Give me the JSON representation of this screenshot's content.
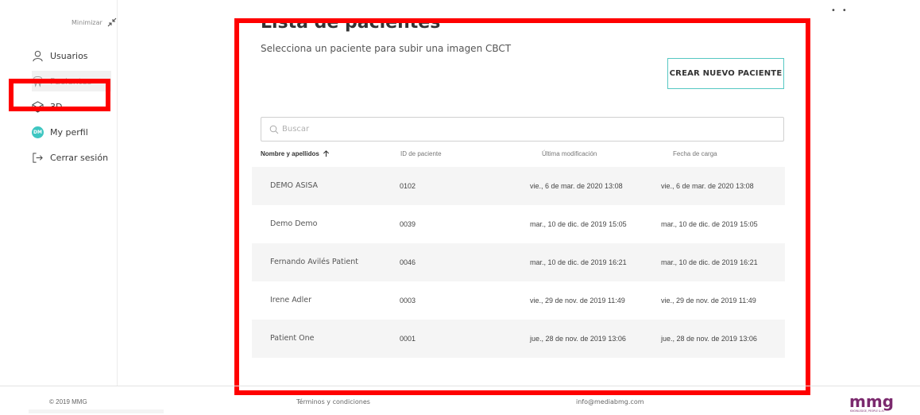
{
  "sidebar": {
    "minimize_label": "Minimizar",
    "items": [
      {
        "label": "Usuarios",
        "icon": "user-icon"
      },
      {
        "label": "Pacientes",
        "icon": "tooth-icon"
      },
      {
        "label": "3D",
        "icon": "cube-icon"
      },
      {
        "label": "My perfil",
        "icon": "avatar",
        "avatar_initials": "DM"
      },
      {
        "label": "Cerrar sesión",
        "icon": "logout-icon"
      }
    ]
  },
  "main": {
    "title": "Lista de pacientes",
    "subtitle": "Selecciona un paciente para subir una imagen CBCT",
    "create_button": "CREAR NUEVO PACIENTE",
    "search_placeholder": "Buscar",
    "table": {
      "columns": [
        "Nombre y apellidos",
        "ID de paciente",
        "Última modificación",
        "Fecha de carga"
      ],
      "rows": [
        {
          "name": "DEMO ASISA",
          "id": "0102",
          "modified": "vie., 6 de mar. de 2020 13:08",
          "loaded": "vie., 6 de mar. de 2020 13:08"
        },
        {
          "name": "Demo Demo",
          "id": "0039",
          "modified": "mar., 10 de dic. de 2019 15:05",
          "loaded": "mar., 10 de dic. de 2019 15:05"
        },
        {
          "name": "Fernando Avilés Patient",
          "id": "0046",
          "modified": "mar., 10 de dic. de 2019 16:21",
          "loaded": "mar., 10 de dic. de 2019 16:21"
        },
        {
          "name": "Irene Adler",
          "id": "0003",
          "modified": "vie., 29 de nov. de 2019 11:49",
          "loaded": "vie., 29 de nov. de 2019 11:49"
        },
        {
          "name": "Patient One",
          "id": "0001",
          "modified": "jue., 28 de nov. de 2019 13:06",
          "loaded": "jue., 28 de nov. de 2019 13:06"
        }
      ]
    }
  },
  "footer": {
    "copyright": "© 2019 MMG",
    "terms": "Términos y condiciones",
    "email": "info@mediabmg.com",
    "logo_text": "mmg",
    "logo_tagline": "KNOWLEDGE, PEOPLE & AI"
  },
  "colors": {
    "accent": "#3ec6c1",
    "highlight": "#ff0000",
    "logo": "#7b2a6e"
  }
}
